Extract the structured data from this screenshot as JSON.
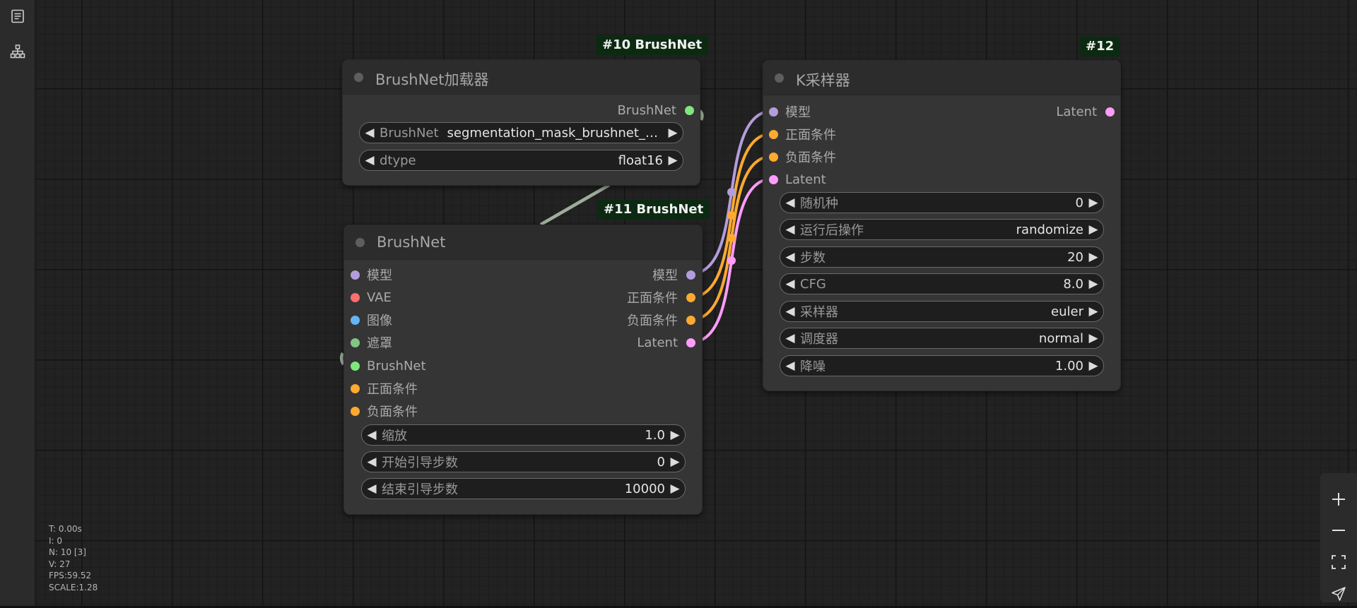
{
  "colors": {
    "model": "#b39ddb",
    "vae": "#ff6e6e",
    "image": "#64b5f6",
    "mask": "#81c784",
    "brushnet": "#7ee87e",
    "conditioning": "#ffa931",
    "latent": "#ff9cf9",
    "badge_bg": "#0c2a12"
  },
  "sidebar": {
    "items": [
      {
        "icon": "document-list-icon"
      },
      {
        "icon": "node-tree-icon"
      }
    ]
  },
  "nodes": {
    "loader": {
      "badge": "#10 BrushNet",
      "title": "BrushNet加载器",
      "outputs": [
        {
          "label": "BrushNet",
          "type": "brushnet"
        }
      ],
      "widgets": [
        {
          "label": "BrushNet",
          "value": "segmentation_mask_brushnet_ckpt"
        },
        {
          "label": "dtype",
          "value": "float16"
        }
      ]
    },
    "brushnet": {
      "badge": "#11 BrushNet",
      "title": "BrushNet",
      "inputs": [
        {
          "label": "模型",
          "type": "model"
        },
        {
          "label": "VAE",
          "type": "vae"
        },
        {
          "label": "图像",
          "type": "image"
        },
        {
          "label": "遮罩",
          "type": "mask"
        },
        {
          "label": "BrushNet",
          "type": "brushnet"
        },
        {
          "label": "正面条件",
          "type": "conditioning"
        },
        {
          "label": "负面条件",
          "type": "conditioning"
        }
      ],
      "outputs": [
        {
          "label": "模型",
          "type": "model"
        },
        {
          "label": "正面条件",
          "type": "conditioning"
        },
        {
          "label": "负面条件",
          "type": "conditioning"
        },
        {
          "label": "Latent",
          "type": "latent"
        }
      ],
      "widgets": [
        {
          "label": "缩放",
          "value": "1.0"
        },
        {
          "label": "开始引导步数",
          "value": "0"
        },
        {
          "label": "结束引导步数",
          "value": "10000"
        }
      ]
    },
    "ksampler": {
      "badge": "#12",
      "title": "K采样器",
      "inputs": [
        {
          "label": "模型",
          "type": "model"
        },
        {
          "label": "正面条件",
          "type": "conditioning"
        },
        {
          "label": "负面条件",
          "type": "conditioning"
        },
        {
          "label": "Latent",
          "type": "latent"
        }
      ],
      "outputs": [
        {
          "label": "Latent",
          "type": "latent"
        }
      ],
      "widgets": [
        {
          "label": "随机种",
          "value": "0"
        },
        {
          "label": "运行后操作",
          "value": "randomize"
        },
        {
          "label": "步数",
          "value": "20"
        },
        {
          "label": "CFG",
          "value": "8.0"
        },
        {
          "label": "采样器",
          "value": "euler"
        },
        {
          "label": "调度器",
          "value": "normal"
        },
        {
          "label": "降噪",
          "value": "1.00"
        }
      ]
    }
  },
  "stats": {
    "t": "T: 0.00s",
    "i": "I: 0",
    "n": "N: 10 [3]",
    "v": "V: 27",
    "fps": "FPS:59.52",
    "scale": "SCALE:1.28"
  },
  "zoom_controls": [
    {
      "icon": "zoom-in-icon"
    },
    {
      "icon": "zoom-out-icon"
    },
    {
      "icon": "fit-view-icon"
    },
    {
      "icon": "locate-icon"
    }
  ]
}
